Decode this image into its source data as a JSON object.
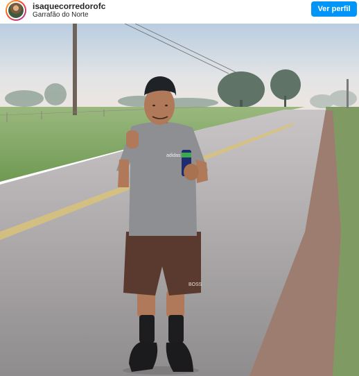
{
  "post": {
    "username": "isaquecorredorofc",
    "location": "Garrafão do Norte",
    "profile_button_label": "Ver perfil"
  },
  "photo": {
    "shirt_logo_text": "adidas",
    "shorts_logo_text": "BOSS"
  },
  "colors": {
    "accent": "#0095f6",
    "text": "#262626"
  },
  "icons": [
    "profile-avatar"
  ]
}
